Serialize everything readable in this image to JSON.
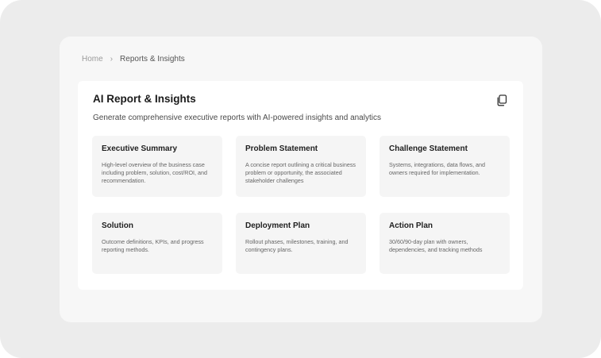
{
  "breadcrumb": {
    "home": "Home",
    "separator": "›",
    "current": "Reports & Insights"
  },
  "header": {
    "title": "AI Report & Insights",
    "subtitle": "Generate comprehensive executive reports with AI-powered insights and analytics",
    "copy_icon": "copy-icon"
  },
  "reports": [
    {
      "title": "Executive Summary",
      "description": "High-level overview of the business case including problem, solution, cost/ROI, and recommendation."
    },
    {
      "title": "Problem Statement",
      "description": "A concise report outlining a critical business problem or opportunity, the associated stakeholder challenges"
    },
    {
      "title": "Challenge Statement",
      "description": "Systems, integrations, data flows, and owners required for implementation."
    },
    {
      "title": "Solution",
      "description": "Outcome definitions, KPIs, and progress reporting methods."
    },
    {
      "title": "Deployment Plan",
      "description": "Rollout phases, milestones, training, and contingency plans."
    },
    {
      "title": "Action Plan",
      "description": "30/60/90-day plan with owners, dependencies, and tracking methods"
    }
  ]
}
